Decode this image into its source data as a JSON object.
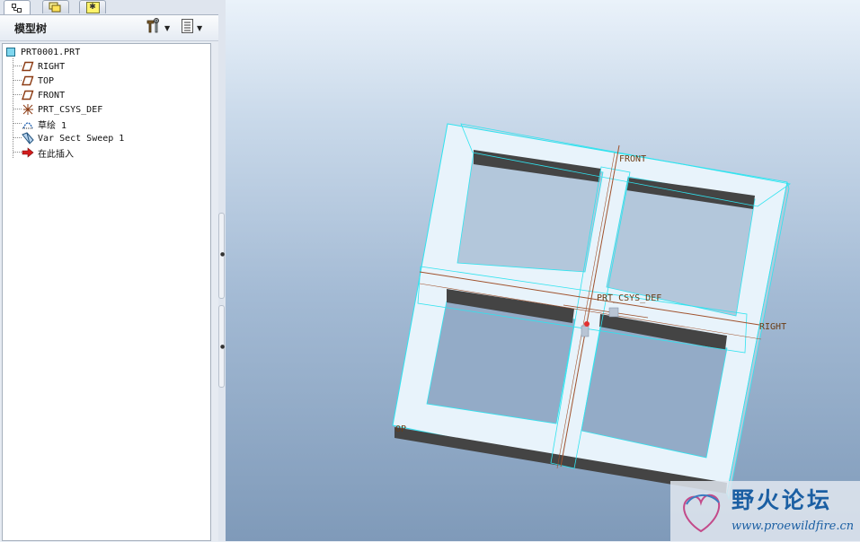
{
  "tabs": [
    {
      "name": "model-tree-tab",
      "icon": "model-tree-icon",
      "active": true
    },
    {
      "name": "layers-tab",
      "icon": "layers-icon",
      "active": false
    },
    {
      "name": "favorites-tab",
      "icon": "star-folder-icon",
      "active": false
    }
  ],
  "model_tree": {
    "title": "模型树",
    "settings_icon": "tools-icon",
    "show_icon": "list-view-icon",
    "root": "PRT0001.PRT",
    "items": [
      {
        "label": "RIGHT",
        "icon": "datum-plane-icon"
      },
      {
        "label": "TOP",
        "icon": "datum-plane-icon"
      },
      {
        "label": "FRONT",
        "icon": "datum-plane-icon"
      },
      {
        "label": "PRT_CSYS_DEF",
        "icon": "coordinate-system-icon"
      },
      {
        "label": "草绘 1",
        "icon": "sketch-icon"
      },
      {
        "label": "Var Sect Sweep 1",
        "icon": "sweep-icon"
      },
      {
        "label": "在此插入",
        "icon": "insert-here-arrow-icon"
      }
    ]
  },
  "viewport": {
    "datum_labels": {
      "front": "FRONT",
      "right": "RIGHT",
      "csys": "PRT_CSYS_DEF",
      "top": "OP"
    },
    "colors": {
      "highlight_edge": "#2fe3ef",
      "model_face": "#e8f3fb",
      "inner_dark_face": "#444444",
      "datum_line": "#a0522d"
    }
  },
  "watermark": {
    "title": "野火论坛",
    "url": "www.proewildfire.cn"
  }
}
